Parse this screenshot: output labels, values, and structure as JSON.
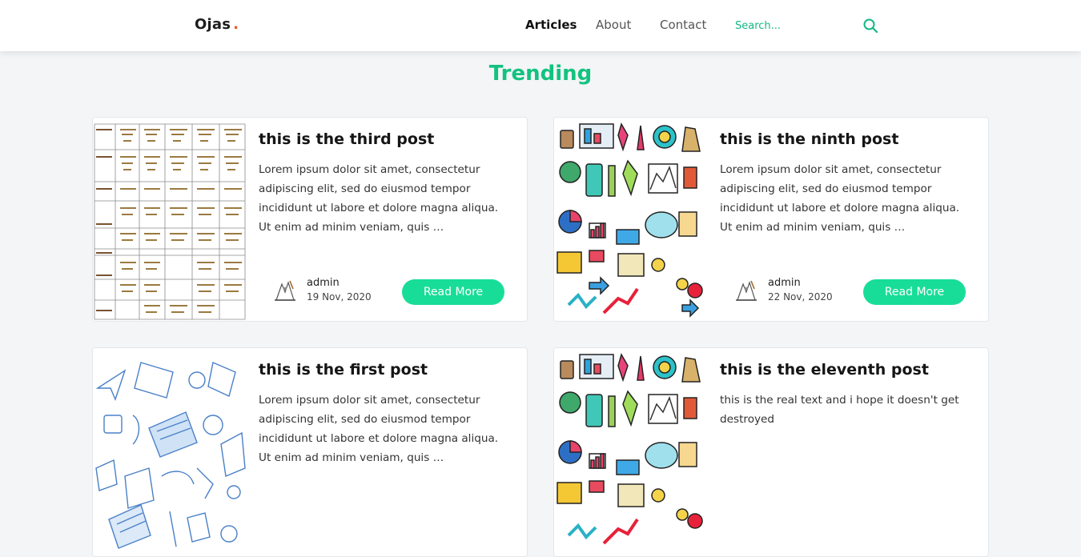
{
  "brand": {
    "name": "Ojas",
    "dot": "."
  },
  "nav": {
    "links": [
      {
        "label": "Articles",
        "active": true
      },
      {
        "label": "About",
        "active": false
      },
      {
        "label": "Contact",
        "active": false
      }
    ],
    "search": {
      "placeholder": "Search...",
      "icon": "search-icon"
    }
  },
  "section": {
    "title": "Trending"
  },
  "colors": {
    "accent": "#18dd98",
    "title_green": "#13c27f",
    "brand_dot": "#f0552f",
    "background": "#f3f5f7"
  },
  "posts": [
    {
      "title": "this is the third post",
      "excerpt": "Lorem ipsum dolor sit amet, consectetur adipiscing elit, sed do eiusmod tempor incididunt ut labore et dolore magna aliqua. Ut enim ad minim veniam, quis …",
      "author": "admin",
      "date": "19 Nov, 2020",
      "button": "Read More",
      "thumbnail": "timetable-image"
    },
    {
      "title": "this is the ninth post",
      "excerpt": "Lorem ipsum dolor sit amet, consectetur adipiscing elit, sed do eiusmod tempor incididunt ut labore et dolore magna aliqua. Ut enim ad minim veniam, quis …",
      "author": "admin",
      "date": "22 Nov, 2020",
      "button": "Read More",
      "thumbnail": "doodle-icons-image"
    },
    {
      "title": "this is the first post",
      "excerpt": "Lorem ipsum dolor sit amet, consectetur adipiscing elit, sed do eiusmod tempor incididunt ut labore et dolore magna aliqua. Ut enim ad minim veniam, quis …",
      "thumbnail": "line-art-education-image"
    },
    {
      "title": "this is the eleventh post",
      "excerpt": "this is the real text and i hope it doesn't get destroyed",
      "thumbnail": "doodle-icons-image"
    }
  ]
}
